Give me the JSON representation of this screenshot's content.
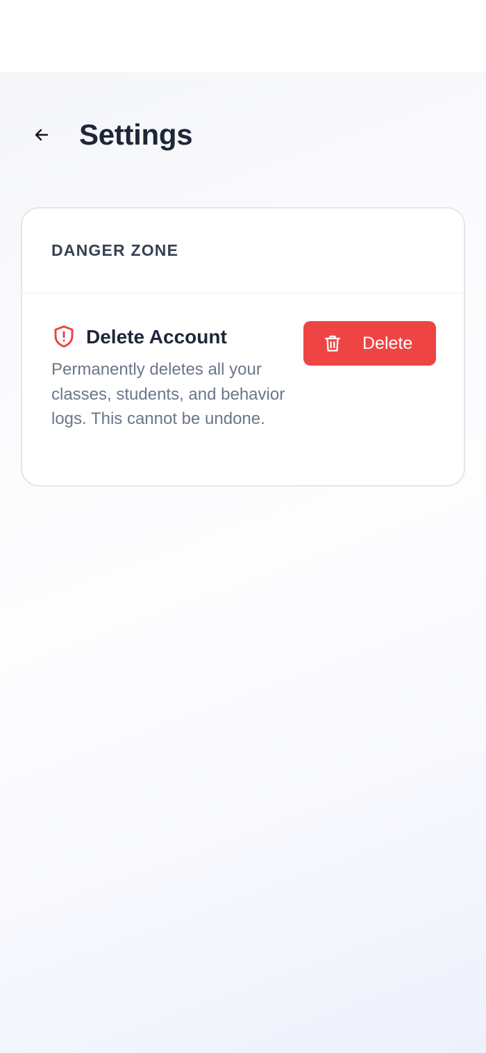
{
  "header": {
    "title": "Settings",
    "back_icon": "arrow-left-icon"
  },
  "danger_zone": {
    "title": "DANGER ZONE",
    "delete_account": {
      "icon": "shield-alert-icon",
      "title": "Delete Account",
      "description": "Permanently deletes all your classes, students, and behavior logs. This cannot be undone.",
      "button_label": "Delete",
      "button_icon": "trash-icon"
    }
  },
  "colors": {
    "danger": "#ef4444",
    "heading": "#1e2638",
    "muted": "#6b7689"
  }
}
